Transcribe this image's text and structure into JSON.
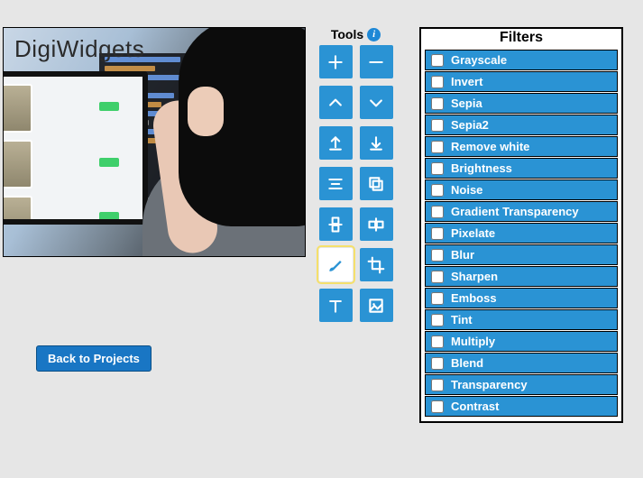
{
  "canvas": {
    "logo_text": "DigiWidgets"
  },
  "tools": {
    "header": "Tools",
    "info_symbol": "i",
    "buttons": [
      {
        "name": "zoom-in",
        "icon": "plus"
      },
      {
        "name": "zoom-out",
        "icon": "minus"
      },
      {
        "name": "move-up",
        "icon": "chev-up"
      },
      {
        "name": "move-down",
        "icon": "chev-down"
      },
      {
        "name": "export",
        "icon": "export"
      },
      {
        "name": "import",
        "icon": "import"
      },
      {
        "name": "align",
        "icon": "align"
      },
      {
        "name": "copy",
        "icon": "copy"
      },
      {
        "name": "flip-v",
        "icon": "flip-v"
      },
      {
        "name": "flip-h",
        "icon": "flip-h"
      },
      {
        "name": "brush",
        "icon": "brush",
        "selected": true
      },
      {
        "name": "crop",
        "icon": "crop"
      },
      {
        "name": "text",
        "icon": "text"
      },
      {
        "name": "image",
        "icon": "image"
      }
    ]
  },
  "filters": {
    "title": "Filters",
    "items": [
      "Grayscale",
      "Invert",
      "Sepia",
      "Sepia2",
      "Remove white",
      "Brightness",
      "Noise",
      "Gradient Transparency",
      "Pixelate",
      "Blur",
      "Sharpen",
      "Emboss",
      "Tint",
      "Multiply",
      "Blend",
      "Transparency",
      "Contrast"
    ]
  },
  "actions": {
    "back_label": "Back to Projects"
  }
}
